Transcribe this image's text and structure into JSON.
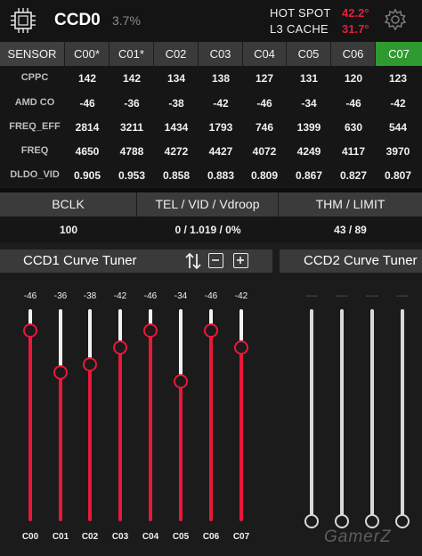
{
  "header": {
    "ccd_name": "CCD0",
    "ccd_load": "3.7%",
    "hotspot_label": "HOT SPOT",
    "hotspot_value": "42.2°",
    "l3_label": "L3 CACHE",
    "l3_value": "31.7°"
  },
  "sensor_table": {
    "columns": [
      "SENSOR",
      "C00*",
      "C01*",
      "C02",
      "C03",
      "C04",
      "C05",
      "C06",
      "C07"
    ],
    "active_column": "C07",
    "rows": [
      {
        "label": "CPPC",
        "values": [
          "142",
          "142",
          "134",
          "138",
          "127",
          "131",
          "120",
          "123"
        ]
      },
      {
        "label": "AMD CO",
        "values": [
          "-46",
          "-36",
          "-38",
          "-42",
          "-46",
          "-34",
          "-46",
          "-42"
        ]
      },
      {
        "label": "FREQ_EFF",
        "values": [
          "2814",
          "3211",
          "1434",
          "1793",
          "746",
          "1399",
          "630",
          "544"
        ]
      },
      {
        "label": "FREQ",
        "values": [
          "4650",
          "4788",
          "4272",
          "4427",
          "4072",
          "4249",
          "4117",
          "3970"
        ]
      },
      {
        "label": "DLDO_VID",
        "values": [
          "0.905",
          "0.953",
          "0.858",
          "0.883",
          "0.809",
          "0.867",
          "0.827",
          "0.807"
        ]
      }
    ]
  },
  "status": {
    "bclk_label": "BCLK",
    "tel_label": "TEL / VID / Vdroop",
    "thm_label": "THM / LIMIT",
    "bclk_value": "100",
    "tel_value": "0 / 1.019 / 0%",
    "thm_value": "43 / 89"
  },
  "ccd1_tuner": {
    "title": "CCD1 Curve Tuner",
    "offsets": [
      "-46",
      "-36",
      "-38",
      "-42",
      "-46",
      "-34",
      "-46",
      "-42"
    ],
    "cores": [
      "C00",
      "C01",
      "C02",
      "C03",
      "C04",
      "C05",
      "C06",
      "C07"
    ],
    "slider_levels": [
      0.9,
      0.7,
      0.74,
      0.82,
      0.9,
      0.66,
      0.9,
      0.82
    ]
  },
  "ccd2_tuner": {
    "title": "CCD2 Curve Tuner",
    "offsets": [
      "----",
      "----",
      "----",
      "----"
    ],
    "slider_levels": [
      0,
      0,
      0,
      0
    ]
  },
  "watermark": "GamerZ",
  "colors": {
    "accent_red": "#e8183a",
    "active_green": "#2f9a2f",
    "header_cell": "#3a3a3a"
  }
}
